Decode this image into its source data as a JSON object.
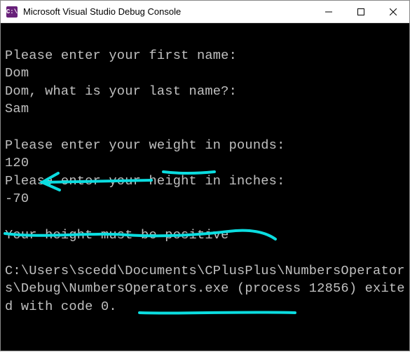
{
  "window": {
    "title": "Microsoft Visual Studio Debug Console",
    "icon_label": "C:\\"
  },
  "console": {
    "lines": [
      "Please enter your first name:",
      "Dom",
      "Dom, what is your last name?:",
      "Sam",
      "",
      "Please enter your weight in pounds:",
      "120",
      "Please enter your height in inches:",
      "-70",
      "",
      "Your height must be positive",
      "",
      "C:\\Users\\scedd\\Documents\\CPlusPlus\\NumbersOperators\\Debug\\NumbersOperators.exe (process 12856) exited with code 0."
    ]
  },
  "annotations": {
    "color": "#0bdde0",
    "marks": [
      "underline-height-word",
      "arrow-to-minus70",
      "underline-positive-sentence",
      "underline-exited-with-code-0"
    ]
  }
}
